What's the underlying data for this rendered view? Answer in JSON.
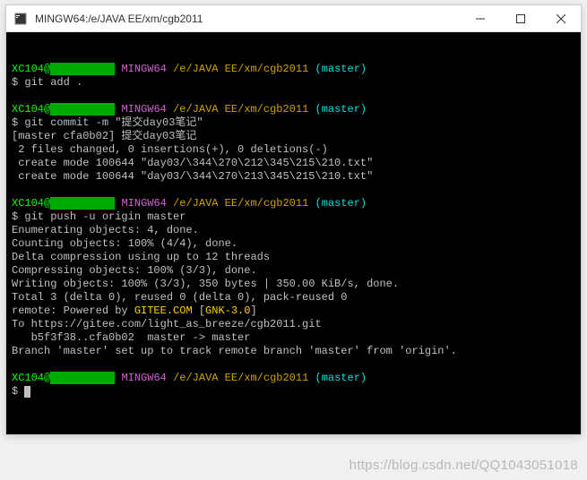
{
  "window": {
    "title": "MINGW64:/e/JAVA EE/xm/cgb2011"
  },
  "prompt": {
    "user": "XC104@",
    "redacted": "          ",
    "shell": "MINGW64",
    "path": "/e/JAVA EE/xm/cgb2011",
    "branch": "(master)",
    "symbol": "$"
  },
  "lines": {
    "cmd_add": "git add .",
    "cmd_commit": "git commit -m \"提交day03笔记\"",
    "commit_1": "[master cfa0b02] 提交day03笔记",
    "commit_2": " 2 files changed, 0 insertions(+), 0 deletions(-)",
    "commit_3": " create mode 100644 \"day03/\\344\\270\\212\\345\\215\\210.txt\"",
    "commit_4": " create mode 100644 \"day03/\\344\\270\\213\\345\\215\\210.txt\"",
    "cmd_push": "git push -u origin master",
    "push_1": "Enumerating objects: 4, done.",
    "push_2": "Counting objects: 100% (4/4), done.",
    "push_3": "Delta compression using up to 12 threads",
    "push_4": "Compressing objects: 100% (3/3), done.",
    "push_5": "Writing objects: 100% (3/3), 350 bytes | 350.00 KiB/s, done.",
    "push_6": "Total 3 (delta 0), reused 0 (delta 0), pack-reused 0",
    "remote_prefix": "remote: Powered by ",
    "gitee": "GITEE.COM",
    "bracket_open": " [",
    "gnk": "GNK-3.0",
    "bracket_close": "]",
    "push_8": "To https://gitee.com/light_as_breeze/cgb2011.git",
    "push_9": "   b5f3f38..cfa0b02  master -> master",
    "push_10": "Branch 'master' set up to track remote branch 'master' from 'origin'."
  },
  "watermark": "https://blog.csdn.net/QQ1043051018"
}
